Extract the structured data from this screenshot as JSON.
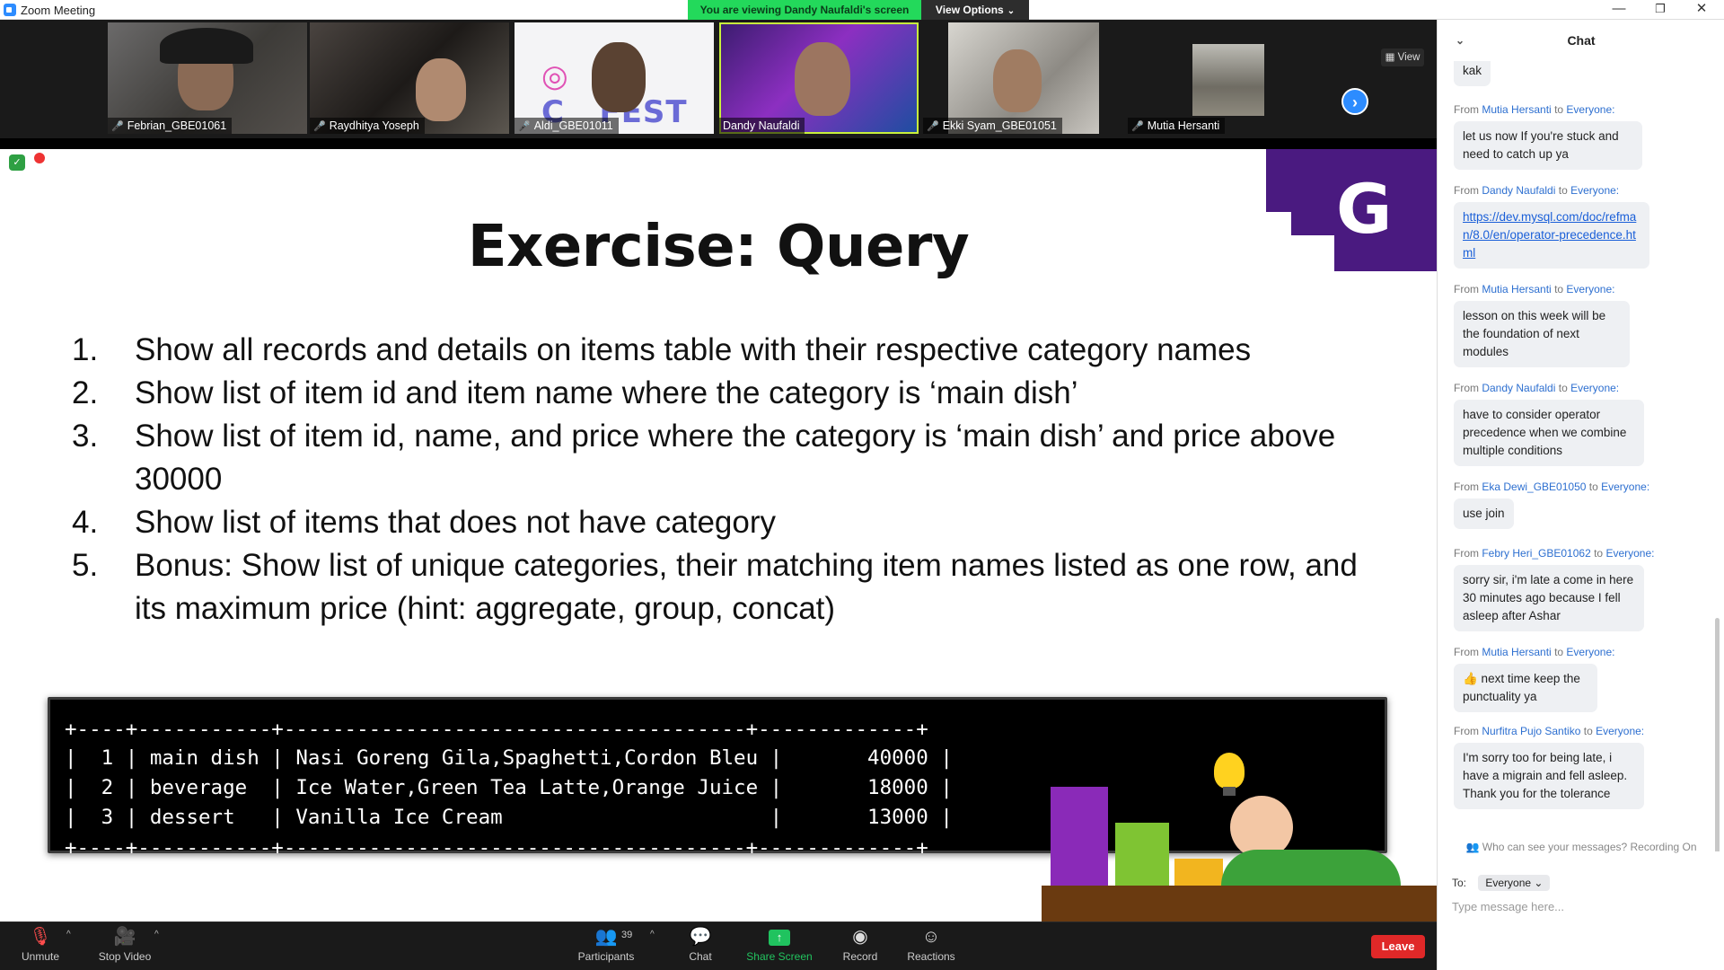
{
  "window": {
    "title": "Zoom Meeting",
    "banner": "You are viewing Dandy Naufaldi's screen",
    "view_options": "View Options"
  },
  "participants": [
    {
      "name": "Febrian_GBE01061",
      "muted": true
    },
    {
      "name": "Raydhitya Yoseph",
      "muted": true
    },
    {
      "name": "Aldi_GBE01011",
      "muted": true
    },
    {
      "name": "Dandy Naufaldi",
      "muted": false
    },
    {
      "name": "Ekki Syam_GBE01051",
      "muted": true
    },
    {
      "name": "Mutia Hersanti",
      "muted": true
    }
  ],
  "strip": {
    "view_label": "View"
  },
  "slide": {
    "title": "Exercise: Query",
    "items": [
      {
        "num": "1.",
        "text": "Show all records and details on items table with their respective category names"
      },
      {
        "num": "2.",
        "text": "Show list of item id and item name where the category is ‘main dish’"
      },
      {
        "num": "3.",
        "text": "Show list of item id, name, and price where the category is ‘main dish’ and price above 30000"
      },
      {
        "num": "4.",
        "text": "Show list of items that does not have category"
      },
      {
        "num": "5.",
        "text": "Bonus: Show list of unique categories, their matching item names listed as one row, and its maximum price (hint: aggregate, group, concat)"
      }
    ],
    "terminal_lines": [
      "+----+-----------+--------------------------------------+-------------+",
      "|  1 | main dish | Nasi Goreng Gila,Spaghetti,Cordon Bleu |       40000 |",
      "|  2 | beverage  | Ice Water,Green Tea Latte,Orange Juice |       18000 |",
      "|  3 | dessert   | Vanilla Ice Cream                      |       13000 |",
      "+----+-----------+--------------------------------------+-------------+"
    ]
  },
  "toolbar": {
    "unmute": "Unmute",
    "stop_video": "Stop Video",
    "participants": "Participants",
    "participants_count": "39",
    "chat": "Chat",
    "share": "Share Screen",
    "record": "Record",
    "reactions": "Reactions",
    "leave": "Leave"
  },
  "chat": {
    "title": "Chat",
    "first_fragment": "kak",
    "messages": [
      {
        "from": "Mutia Hersanti",
        "to": "Everyone:",
        "text": "let us now If you're stuck and need to catch up ya"
      },
      {
        "from": "Dandy Naufaldi",
        "to": "Everyone:",
        "text": "https://dev.mysql.com/doc/refman/8.0/en/operator-precedence.html",
        "link": true
      },
      {
        "from": "Mutia Hersanti",
        "to": "Everyone:",
        "text": "lesson on this week will be the foundation of next modules"
      },
      {
        "from": "Dandy Naufaldi",
        "to": "Everyone:",
        "text": "have to consider operator precedence when we combine multiple conditions"
      },
      {
        "from": "Eka Dewi_GBE01050",
        "to": "Everyone:",
        "text": "use join"
      },
      {
        "from": "Febry Heri_GBE01062",
        "to": "Everyone:",
        "text": "sorry sir, i'm late a come in here 30 minutes ago because I fell asleep after Ashar"
      },
      {
        "from": "Mutia Hersanti",
        "to": "Everyone:",
        "text": "👍 next time keep the punctuality ya"
      },
      {
        "from": "Nurfitra Pujo Santiko",
        "to": "Everyone:",
        "text": "I'm sorry too for being late, i have a migrain and fell asleep. Thank you for the tolerance"
      }
    ],
    "from_word": "From",
    "to_word": "to",
    "privacy": "Who can see your messages? Recording On",
    "to_label": "To:",
    "to_value": "Everyone",
    "placeholder": "Type message here..."
  }
}
